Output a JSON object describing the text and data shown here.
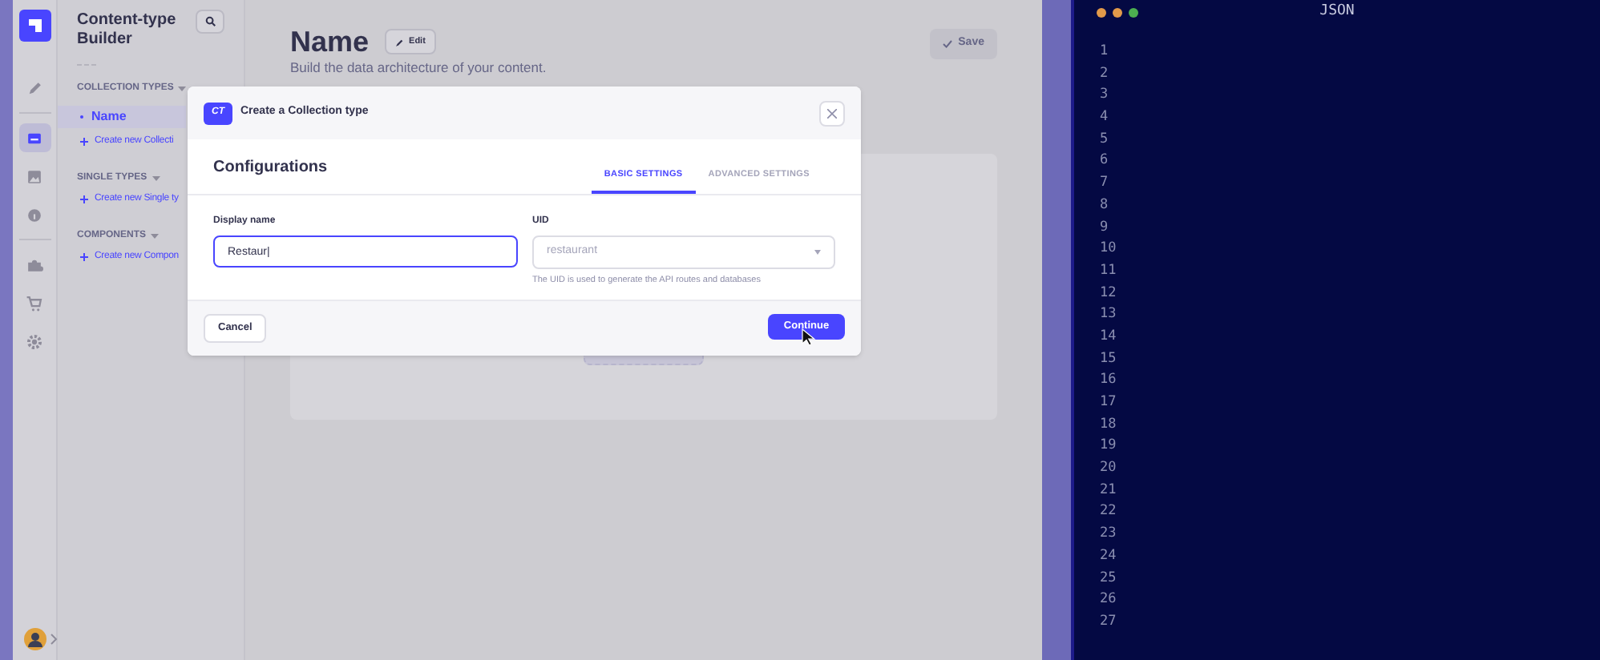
{
  "nav": {
    "items": [
      {
        "selected": false
      },
      {
        "selected": true
      },
      {
        "selected": false
      },
      {
        "selected": false
      },
      {
        "selected": false
      },
      {
        "selected": false
      },
      {
        "selected": false
      }
    ]
  },
  "sidebar": {
    "title": "Content-type Builder",
    "sections": [
      {
        "heading": "COLLECTION TYPES",
        "items": [
          {
            "label": "Name",
            "selected": true
          }
        ],
        "create": "Create new Collecti"
      },
      {
        "heading": "SINGLE TYPES",
        "create": "Create new Single ty"
      },
      {
        "heading": "COMPONENTS",
        "create": "Create new Compon"
      }
    ]
  },
  "header": {
    "title": "Name",
    "edit": "Edit",
    "subtitle": "Build the data architecture of your content.",
    "save": "Save"
  },
  "modal": {
    "badge": "CT",
    "title": "Create a Collection type",
    "heading": "Configurations",
    "tabs": [
      {
        "label": "BASIC SETTINGS",
        "selected": true
      },
      {
        "label": "ADVANCED SETTINGS",
        "selected": false
      }
    ],
    "display_name": {
      "label": "Display name",
      "value": "Restaur|"
    },
    "uid": {
      "label": "UID",
      "value": "restaurant",
      "hint": "The UID is used to generate the API routes and databases"
    },
    "cancel": "Cancel",
    "continue": "Continue"
  },
  "editor": {
    "title": "JSON",
    "line_numbers": [
      "1",
      "2",
      "3",
      "4",
      "5",
      "6",
      "7",
      "8",
      "9",
      "10",
      "11",
      "12",
      "13",
      "14",
      "15",
      "16",
      "17",
      "18",
      "19",
      "20",
      "21",
      "22",
      "23",
      "24",
      "25",
      "26",
      "27"
    ]
  }
}
